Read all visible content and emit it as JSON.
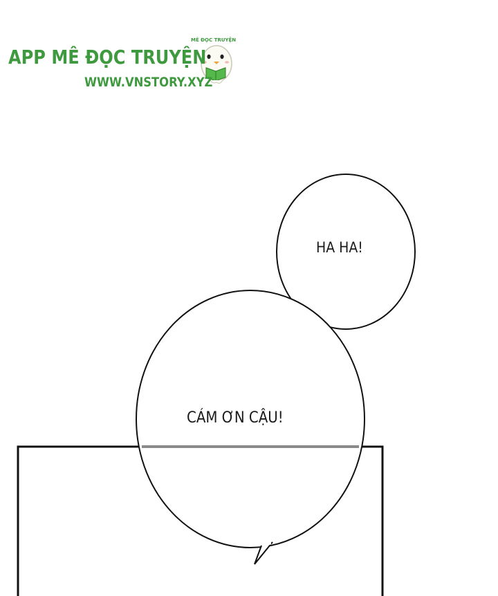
{
  "watermark": {
    "title": "APP MÊ ĐỌC TRUYỆN",
    "url": "WWW.VNSTORY.XYZ",
    "mascot_caption": "MÊ ĐỌC TRUYỆN",
    "mascot_icon": "ghost-reading-book-icon",
    "color": "#3f9a3f"
  },
  "speech_bubbles": [
    {
      "text": "HA HA!"
    },
    {
      "text": "CẢM ƠN CẬU!"
    }
  ]
}
